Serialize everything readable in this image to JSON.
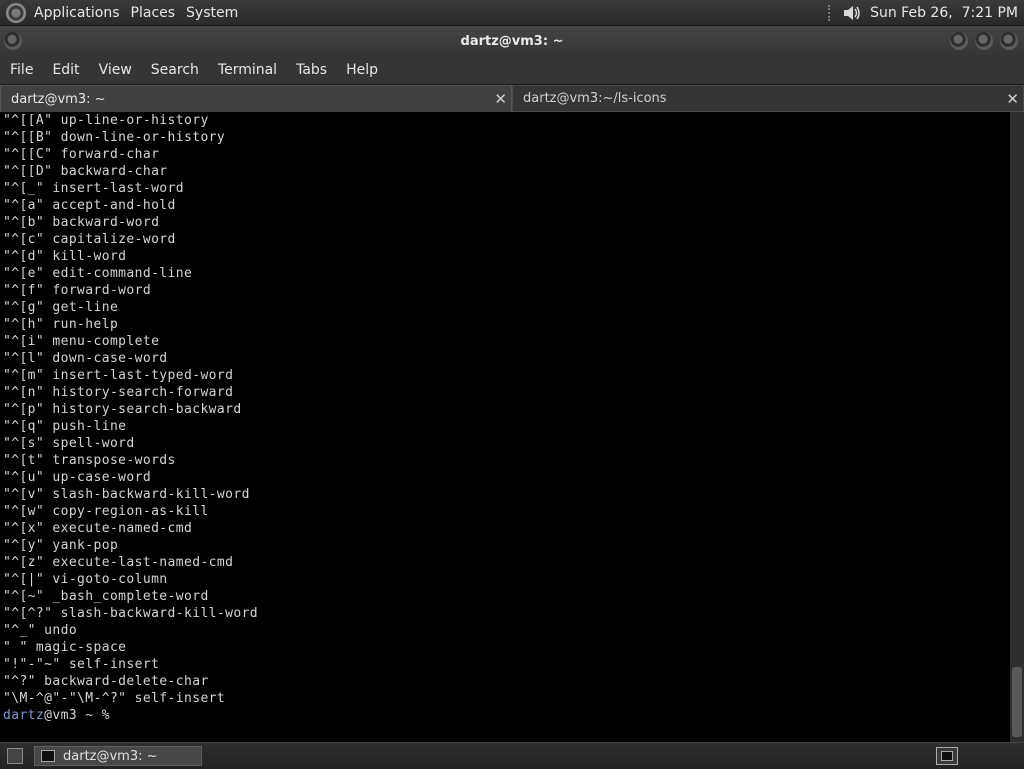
{
  "top_panel": {
    "menus": [
      "Applications",
      "Places",
      "System"
    ],
    "clock": "Sun Feb 26,  7:21 PM"
  },
  "window": {
    "title": "dartz@vm3: ~"
  },
  "menubar": [
    "File",
    "Edit",
    "View",
    "Search",
    "Terminal",
    "Tabs",
    "Help"
  ],
  "tabs": [
    {
      "label": "dartz@vm3: ~",
      "active": true
    },
    {
      "label": "dartz@vm3:~/ls-icons",
      "active": false
    }
  ],
  "terminal": {
    "lines": [
      "\"^[[A\" up-line-or-history",
      "\"^[[B\" down-line-or-history",
      "\"^[[C\" forward-char",
      "\"^[[D\" backward-char",
      "\"^[_\" insert-last-word",
      "\"^[a\" accept-and-hold",
      "\"^[b\" backward-word",
      "\"^[c\" capitalize-word",
      "\"^[d\" kill-word",
      "\"^[e\" edit-command-line",
      "\"^[f\" forward-word",
      "\"^[g\" get-line",
      "\"^[h\" run-help",
      "\"^[i\" menu-complete",
      "\"^[l\" down-case-word",
      "\"^[m\" insert-last-typed-word",
      "\"^[n\" history-search-forward",
      "\"^[p\" history-search-backward",
      "\"^[q\" push-line",
      "\"^[s\" spell-word",
      "\"^[t\" transpose-words",
      "\"^[u\" up-case-word",
      "\"^[v\" slash-backward-kill-word",
      "\"^[w\" copy-region-as-kill",
      "\"^[x\" execute-named-cmd",
      "\"^[y\" yank-pop",
      "\"^[z\" execute-last-named-cmd",
      "\"^[|\" vi-goto-column",
      "\"^[~\" _bash_complete-word",
      "\"^[^?\" slash-backward-kill-word",
      "\"^_\" undo",
      "\" \" magic-space",
      "\"!\"-\"~\" self-insert",
      "\"^?\" backward-delete-char",
      "\"\\M-^@\"-\"\\M-^?\" self-insert"
    ],
    "prompt": {
      "user": "dartz",
      "host": "@vm3",
      "dir": " ~ %"
    }
  },
  "taskbar": {
    "item_label": "dartz@vm3: ~"
  },
  "icons": {
    "logo": "gnome-foot-icon",
    "volume": "speaker-icon",
    "terminal": "terminal-icon"
  }
}
